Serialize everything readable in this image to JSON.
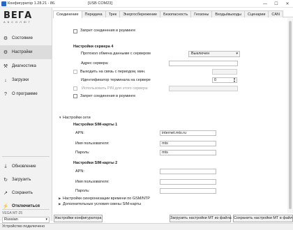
{
  "window": {
    "title": "Конфигуратор 1.28.21 - 86.",
    "com_port": "[USB COM23]",
    "minimize": "—",
    "maximize": "☐",
    "close": "✕"
  },
  "logo": {
    "brand": "ВЕГА",
    "sub": "АБСОЛЮТ"
  },
  "sidebar": {
    "nav": [
      {
        "label": "Состояние",
        "icon": "⚙"
      },
      {
        "label": "Настройки",
        "icon": "⚙"
      },
      {
        "label": "Диагностика",
        "icon": "⚒"
      },
      {
        "label": "Загрузки",
        "icon": "↓"
      },
      {
        "label": "О программе",
        "icon": "?"
      }
    ],
    "actions": [
      {
        "label": "Обновление",
        "icon": "⤓"
      },
      {
        "label": "Загрузить",
        "icon": "↻"
      },
      {
        "label": "Сохранить",
        "icon": "↗"
      },
      {
        "label": "Отключиться",
        "icon": "⚡"
      }
    ],
    "device": "VEGA MT-25",
    "language": "Russian"
  },
  "tabs": [
    "Соединение",
    "Передача",
    "Трек",
    "Энергосбережение",
    "Безопасность",
    "Геозоны",
    "Входы/выходы",
    "Сценарии",
    "CAN"
  ],
  "content": {
    "roaming_top": "Запрет соединения в роуминге",
    "server4": {
      "title": "Настройки сервера 4",
      "protocol_label": "Протокол обмена данными с сервером",
      "protocol_value": "Выключен",
      "address_label": "Адрес сервера:",
      "period_label": "Выходить на связь с периодом, мин.",
      "terminal_id_label": "Идентификатор терминала на сервере",
      "terminal_id_value": "0",
      "pin_label": "Использовать PIN для этого сервера:",
      "roaming_label": "Запрет соединения в роуминге"
    },
    "network": {
      "title": "Настройки сети",
      "sim1": {
        "title": "Настройки SIM-карты 1",
        "apn_label": "APN:",
        "apn_value": "internet.mts.ru",
        "user_label": "Имя пользователя:",
        "user_value": "mts",
        "pass_label": "Пароль:",
        "pass_value": "mts"
      },
      "sim2": {
        "title": "Настройки SIM-карты 2",
        "apn_label": "APN:",
        "user_label": "Имя пользователя:",
        "pass_label": "Пароль:"
      }
    },
    "gsm_sync": "Настройки синхронизации времени по GSM/NTP",
    "sim_extra": "Дополнительные условия смены SIM-карты"
  },
  "bottom": {
    "settings_btn": "Настройки конфигуратора",
    "load_btn": "Загрузить настройки МТ из файла",
    "save_btn": "Сохранить настройки МТ в файл"
  },
  "status": "Устройство подключено"
}
